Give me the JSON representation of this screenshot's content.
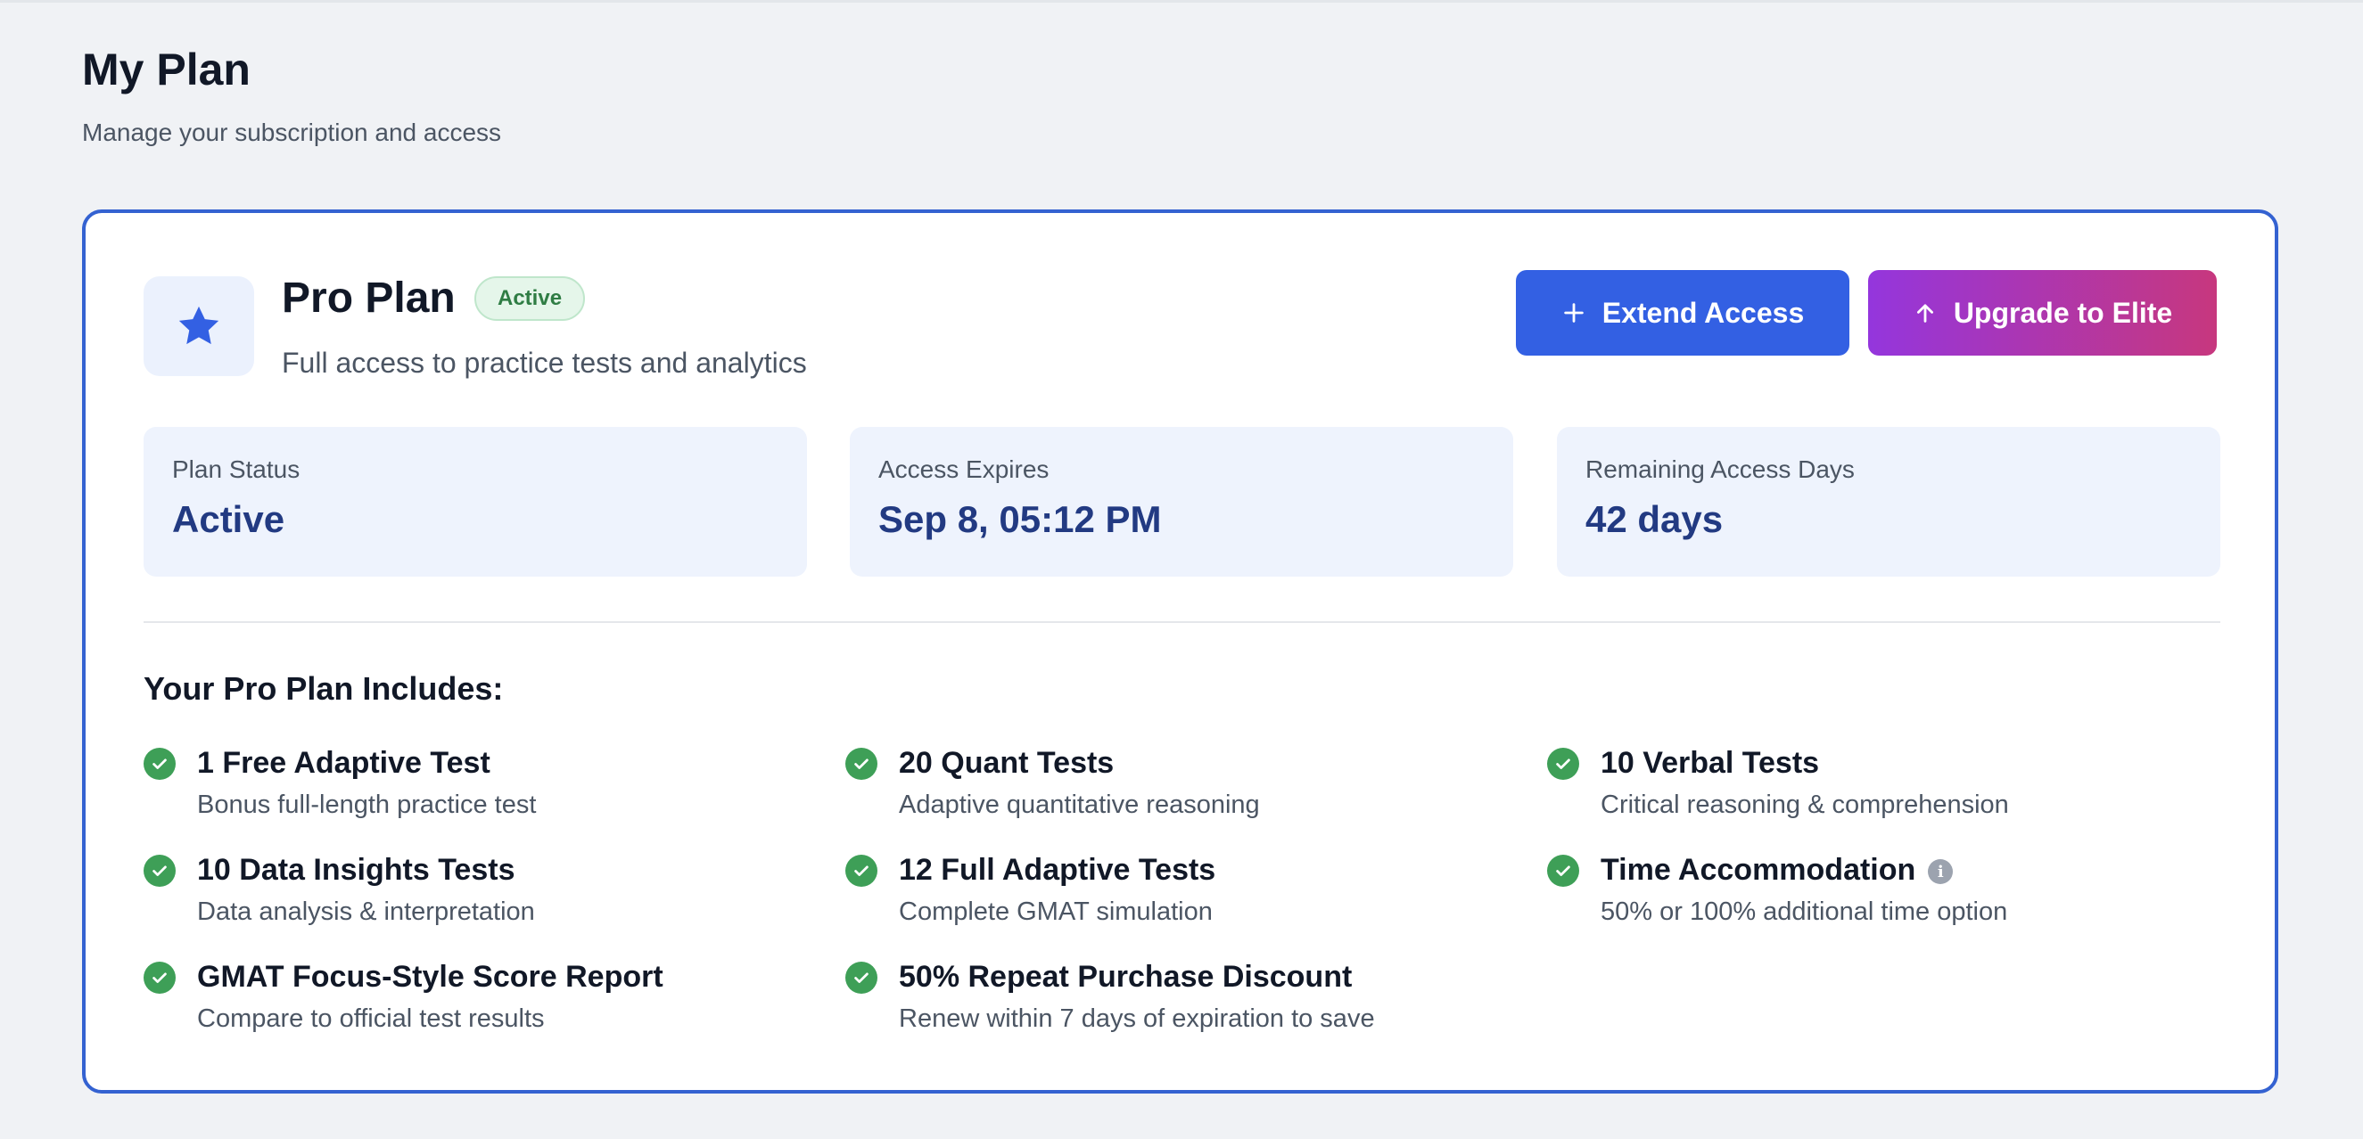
{
  "header": {
    "title": "My Plan",
    "subtitle": "Manage your subscription and access"
  },
  "plan": {
    "icon": "star-icon",
    "name": "Pro Plan",
    "status_badge": "Active",
    "description": "Full access to practice tests and analytics"
  },
  "actions": {
    "extend_label": "Extend Access",
    "extend_icon": "plus-icon",
    "upgrade_label": "Upgrade to Elite",
    "upgrade_icon": "arrow-up-icon"
  },
  "stats": [
    {
      "label": "Plan Status",
      "value": "Active"
    },
    {
      "label": "Access Expires",
      "value": "Sep 8, 05:12 PM"
    },
    {
      "label": "Remaining Access Days",
      "value": "42 days"
    }
  ],
  "includes": {
    "title": "Your Pro Plan Includes:",
    "features": [
      {
        "title": "1 Free Adaptive Test",
        "desc": "Bonus full-length practice test"
      },
      {
        "title": "20 Quant Tests",
        "desc": "Adaptive quantitative reasoning"
      },
      {
        "title": "10 Verbal Tests",
        "desc": "Critical reasoning & comprehension"
      },
      {
        "title": "10 Data Insights Tests",
        "desc": "Data analysis & interpretation"
      },
      {
        "title": "12 Full Adaptive Tests",
        "desc": "Complete GMAT simulation"
      },
      {
        "title": "Time Accommodation",
        "desc": "50% or 100% additional time option",
        "info_icon": "info-icon"
      },
      {
        "title": "GMAT Focus-Style Score Report",
        "desc": "Compare to official test results"
      },
      {
        "title": "50% Repeat Purchase Discount",
        "desc": "Renew within 7 days of expiration to save"
      }
    ]
  },
  "colors": {
    "accent": "#3360e3",
    "card_border": "#3462d1",
    "upgrade_gradient_start": "#9436dd",
    "upgrade_gradient_end": "#c7377e",
    "success": "#3e9f57",
    "stat_value": "#223a82"
  }
}
